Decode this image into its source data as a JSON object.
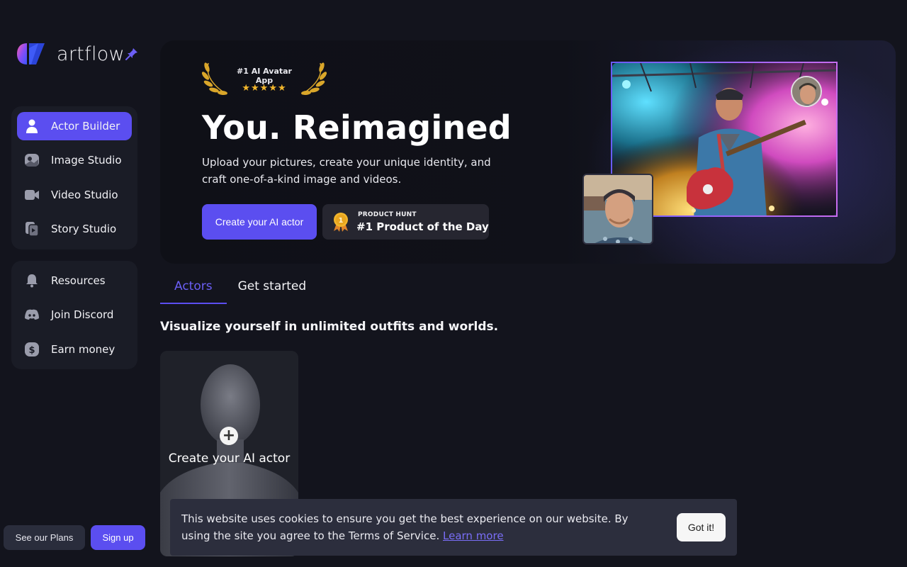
{
  "brand": {
    "name": "artflow"
  },
  "sidebar": {
    "primary_items": [
      {
        "label": "Actor Builder",
        "icon": "person-icon",
        "active": true
      },
      {
        "label": "Image Studio",
        "icon": "image-studio-icon",
        "active": false
      },
      {
        "label": "Video Studio",
        "icon": "video-camera-icon",
        "active": false
      },
      {
        "label": "Story Studio",
        "icon": "story-icon",
        "active": false
      }
    ],
    "secondary_items": [
      {
        "label": "Resources",
        "icon": "bell-icon"
      },
      {
        "label": "Join Discord",
        "icon": "discord-icon"
      },
      {
        "label": "Earn money",
        "icon": "dollar-icon"
      }
    ],
    "plans_label": "See our Plans",
    "signup_label": "Sign up"
  },
  "hero": {
    "award_title": "#1 AI Avatar App",
    "award_stars": "★★★★★",
    "title": "You. Reimagined",
    "subtitle": "Upload your pictures, create your unique identity, and craft one-of-a-kind image and videos.",
    "cta_label": "Create your AI actor",
    "product_hunt_small": "PRODUCT HUNT",
    "product_hunt_big": "#1 Product of the Day",
    "medal_number": "1"
  },
  "tabs": [
    {
      "label": "Actors",
      "active": true
    },
    {
      "label": "Get started",
      "active": false
    }
  ],
  "section_title": "Visualize yourself in unlimited outfits and worlds.",
  "actor_card": {
    "label": "Create your AI actor",
    "plus": "+"
  },
  "cookie": {
    "text": "This website uses cookies to ensure you get the best experience on our website. By using the site you agree to the Terms of Service.",
    "link_label": "Learn more",
    "button_label": "Got it!"
  },
  "colors": {
    "accent": "#5b4ef0",
    "background": "#13141d",
    "star": "#f2b62c"
  }
}
